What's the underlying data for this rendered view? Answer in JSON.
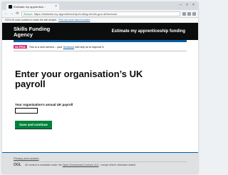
{
  "browser": {
    "tab_title": "Estimate my apprentice...",
    "tab_close": "×",
    "window_controls": [
      "–",
      "□",
      "×"
    ],
    "nav": {
      "back": "←",
      "forward": "→",
      "reload": "⟳"
    },
    "secure_label": "Secure",
    "url": "https://estimate-my-apprenticeship-funding.sfa.bis.gov.uk/forecast",
    "infobar_text": "GOV.UK uses cookies to make the site simpler.",
    "infobar_link": "Find out more about cookies"
  },
  "header": {
    "brand_line1": "Skills Funding",
    "brand_line2": "Agency",
    "service_name": "Estimate my apprenticeship funding"
  },
  "phase_banner": {
    "tag": "ALPHA",
    "text_before": "This is a new service – your",
    "link": "feedback",
    "text_after": "will help us to improve it."
  },
  "main": {
    "heading": "Enter your organisation’s UK payroll",
    "field_label": "Your organisation’s annual UK payroll",
    "input_value": "",
    "button_label": "Save and continue"
  },
  "footer": {
    "link": "Privacy and cookies",
    "logo": "OGL",
    "licence_before": "All content is available under the",
    "licence_link": "Open Government Licence v3.0",
    "licence_after": ", except where otherwise stated"
  },
  "colors": {
    "header_bg": "#0b0c0c",
    "accent_blue": "#005ea5",
    "alpha_tag": "#d53880",
    "button_green": "#00823b",
    "footer_bg": "#dee0e2"
  }
}
